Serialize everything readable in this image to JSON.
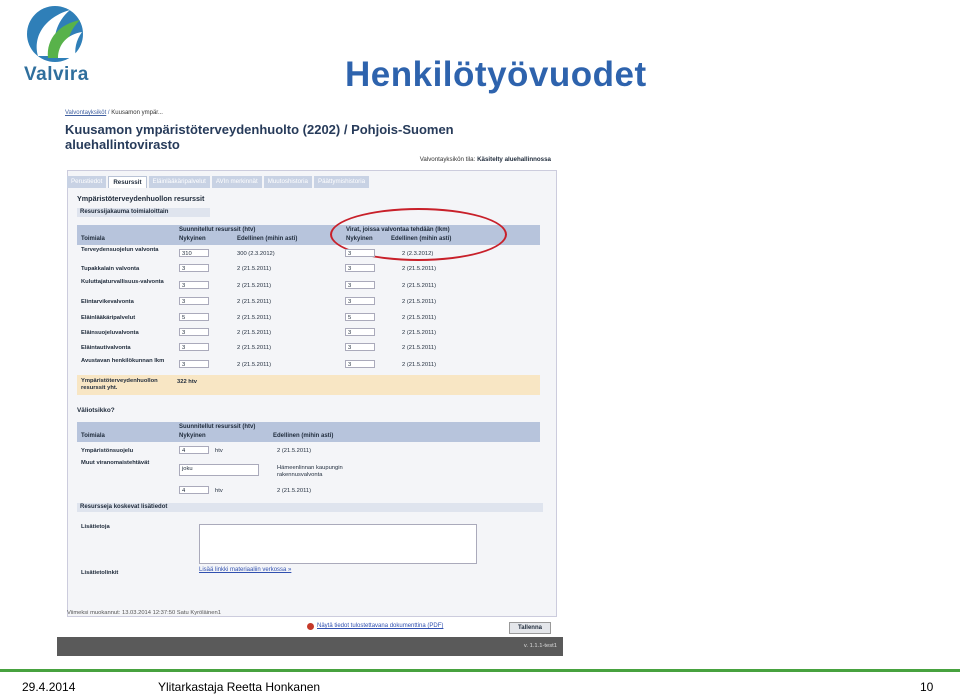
{
  "logo": {
    "name": "Valvira"
  },
  "slide": {
    "title": "Henkilötyövuodet"
  },
  "app": {
    "breadcrumb": [
      "Valvontayksiköt",
      "Kuusamon ympär..."
    ],
    "breadcrumb_sep": "/",
    "page_title": "Kuusamon ympäristöterveydenhuolto (2202) / Pohjois-Suomen aluehallintovirasto",
    "status_label": "Valvontayksikön tila:",
    "status_value": "Käsitelty aluehallinnossa",
    "tabs": [
      "Perustiedot",
      "Resurssit",
      "Eläinlääkäripalvelut",
      "AVIn merkinnät",
      "Muutoshistoria",
      "Päättymishistoria"
    ],
    "active_tab": 1,
    "section_title": "Ympäristöterveydenhuollon resurssit",
    "sub_bar": "Resurssijakauma toimialoittain",
    "table1": {
      "col_toimiala": "Toimiala",
      "group1": "Suunnitellut resurssit (htv)",
      "group2": "Virat, joissa valvontaa tehdään (lkm)",
      "col_nykyinen": "Nykyinen",
      "col_edellinen": "Edellinen (mihin asti)",
      "rows": [
        {
          "label": "Terveydensuojelun valvonta",
          "cur": "310",
          "prev": "300 (2.3.2012)",
          "cur2": "3",
          "prev2": "2 (2.3.2012)"
        },
        {
          "label": "Tupakkalain valvonta",
          "cur": "3",
          "prev": "2 (21.5.2011)",
          "cur2": "3",
          "prev2": "2 (21.5.2011)"
        },
        {
          "label": "Kuluttajaturvallisuus-valvonta",
          "cur": "3",
          "prev": "2 (21.5.2011)",
          "cur2": "3",
          "prev2": "2 (21.5.2011)"
        },
        {
          "label": "Elintarvikevalvonta",
          "cur": "3",
          "prev": "2 (21.5.2011)",
          "cur2": "3",
          "prev2": "2 (21.5.2011)"
        },
        {
          "label": "Eläinlääkäripalvelut",
          "cur": "5",
          "prev": "2 (21.5.2011)",
          "cur2": "5",
          "prev2": "2 (21.5.2011)"
        },
        {
          "label": "Eläinsuojeluvalvonta",
          "cur": "3",
          "prev": "2 (21.5.2011)",
          "cur2": "3",
          "prev2": "2 (21.5.2011)"
        },
        {
          "label": "Eläintautivalvonta",
          "cur": "3",
          "prev": "2 (21.5.2011)",
          "cur2": "3",
          "prev2": "2 (21.5.2011)"
        },
        {
          "label": "Avustavan henkilökunnan lkm",
          "cur": "3",
          "prev": "2 (21.5.2011)",
          "cur2": "3",
          "prev2": "2 (21.5.2011)"
        }
      ],
      "total_label": "Ympäristöterveydenhuollon resurssit yht.",
      "total_value": "322 htv"
    },
    "valiotsikko": "Väliotsikko?",
    "table2": {
      "col_toimiala": "Toimiala",
      "group": "Suunnitellut resurssit (htv)",
      "col_nykyinen": "Nykyinen",
      "col_edellinen": "Edellinen (mihin asti)",
      "unit": "htv",
      "row1_label": "Ympäristönsuojelu",
      "row1_cur": "4",
      "row1_prev": "2 (21.5.2011)",
      "row2_label": "Muut viranomaistehtävät",
      "row2_text": "joku",
      "row2_desc": "Hämeenlinnan kaupungin rakennusvalvonta",
      "row3_cur": "4",
      "row3_prev": "2 (21.5.2011)"
    },
    "additional_bar": "Resursseja koskevat lisätiedot",
    "lisatietoja": "Lisätietoja",
    "lisatietolinkit": "Lisätietolinkit",
    "add_link": "Lisää linkki materiaaliin verkossa »",
    "last_modified": "Viimeksi muokannut: 13.03.2014 12:37:50 Satu Kyröläinen1",
    "pdf_link": "Näytä tiedot tulostettavana dokumenttina (PDF)",
    "save": "Tallenna",
    "version": "v. 1.1.1-test1"
  },
  "footer": {
    "date": "29.4.2014",
    "author": "Ylitarkastaja Reetta Honkanen",
    "page": "10"
  },
  "colors": {
    "title": "#2e63ad",
    "accent_green": "#47a23f",
    "highlight_circle": "#c8202a"
  }
}
